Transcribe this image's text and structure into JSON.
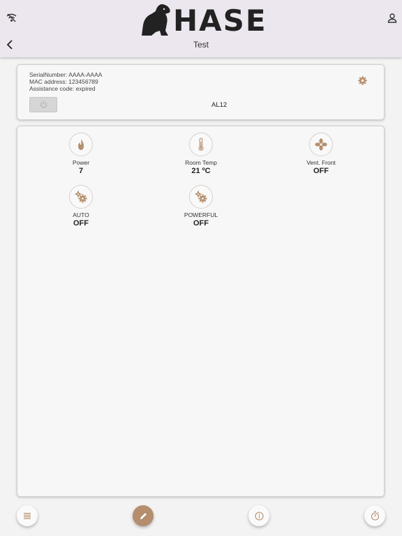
{
  "header": {
    "brand": "HASE",
    "title": "Test"
  },
  "device": {
    "serial_line": "SerialNumber: AAAA-AAAA",
    "mac_line": "MAC address: 123456789",
    "assistance_line": "Assistance code: expired",
    "model": "AL12"
  },
  "status": {
    "tiles": [
      {
        "icon": "flame-icon",
        "label": "Power",
        "value": "7"
      },
      {
        "icon": "thermometer-icon",
        "label": "Room Temp",
        "value": "21 ºC"
      },
      {
        "icon": "fan-icon",
        "label": "Vent. Front",
        "value": "OFF"
      },
      {
        "icon": "gears-icon",
        "label": "AUTO",
        "value": "OFF"
      },
      {
        "icon": "gears-icon",
        "label": "POWERFUL",
        "value": "OFF"
      }
    ]
  },
  "bottom_bar": {
    "buttons": [
      "menu-icon",
      "edit-icon",
      "info-icon",
      "timer-icon"
    ]
  },
  "colors": {
    "accent": "#b48e6d",
    "header_bg": "#ece6ee",
    "disabled_button": "#d6d6d6"
  }
}
